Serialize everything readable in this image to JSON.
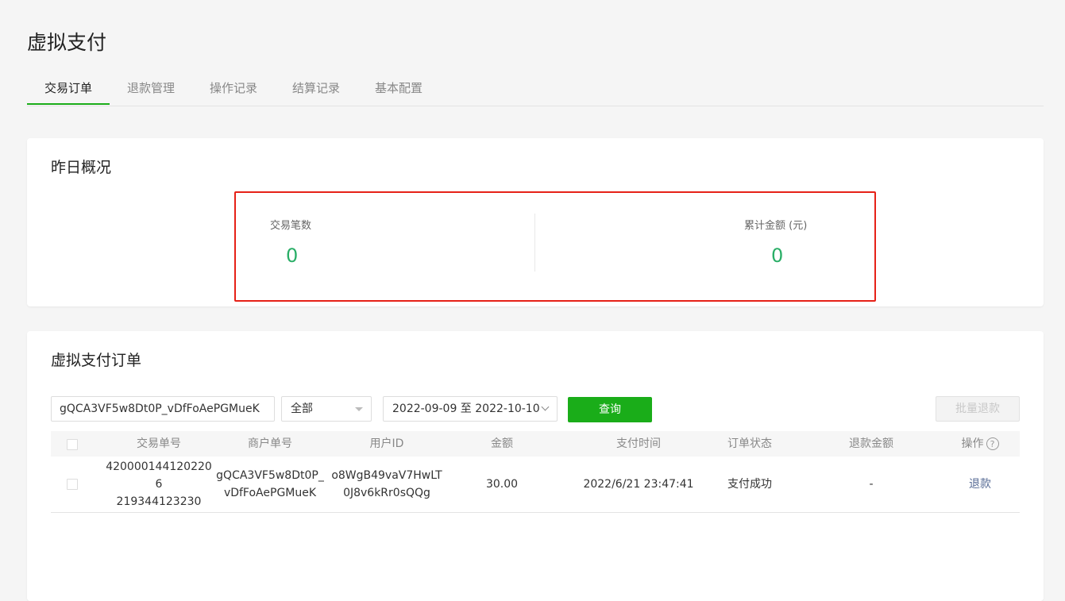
{
  "page": {
    "title": "虚拟支付"
  },
  "tabs": [
    "交易订单",
    "退款管理",
    "操作记录",
    "结算记录",
    "基本配置"
  ],
  "summary": {
    "title": "昨日概况",
    "stats": [
      {
        "label": "交易笔数",
        "value": "0"
      },
      {
        "label": "累计金额 (元)",
        "value": "0"
      }
    ]
  },
  "orders": {
    "title": "虚拟支付订单",
    "search_value": "gQCA3VF5w8Dt0P_vDfFoAePGMueK",
    "status_select": "全部",
    "date_range": "2022-09-09 至 2022-10-10",
    "query_label": "查询",
    "batch_refund_label": "批量退款",
    "columns": [
      "交易单号",
      "商户单号",
      "用户ID",
      "金额",
      "支付时间",
      "订单状态",
      "退款金额",
      "操作"
    ],
    "help_glyph": "?",
    "rows": [
      {
        "trade_no_1": "420000144120220 6",
        "trade_no": [
          "4200001441202206",
          "219344123230"
        ],
        "merchant_no": [
          "gQCA3VF5w8Dt0P_",
          "vDfFoAePGMueK"
        ],
        "user_id": [
          "o8WgB49vaV7HwLT",
          "0J8v6kRr0sQQg"
        ],
        "amount": "30.00",
        "pay_time": "2022/6/21 23:47:41",
        "status": "支付成功",
        "refund_amount": "-",
        "action": "退款"
      }
    ]
  },
  "colors": {
    "accent": "#1aad19",
    "stat": "#2aae67",
    "highlight": "#e62117",
    "link": "#576b95"
  }
}
